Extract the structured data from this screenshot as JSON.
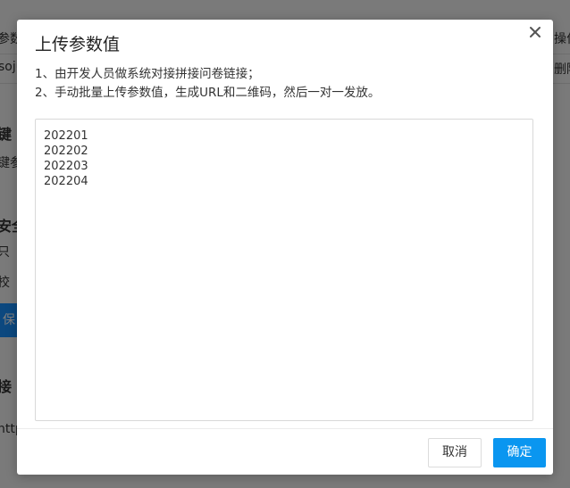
{
  "background": {
    "top_left_label": "参数",
    "top_left_value": "soju",
    "top_right_label": "操作",
    "top_right_value": "删除",
    "section_keyword_title": "键",
    "section_keyword_text": "键参",
    "section_security_title": "安全",
    "security_option_1": "只",
    "security_option_2": "校",
    "save_button_label": "保",
    "section_link_title": "接",
    "link_text": "http"
  },
  "modal": {
    "title": "上传参数值",
    "close_glyph": "×",
    "instructions": [
      "1、由开发人员做系统对接拼接问卷链接；",
      "2、手动批量上传参数值，生成URL和二维码，然后一对一发放。"
    ],
    "textarea_value": "202201\n202202\n202203\n202204",
    "cancel_label": "取消",
    "confirm_label": "确定"
  },
  "colors": {
    "primary": "#0a96f0",
    "overlay": "rgba(0,0,0,0.5)"
  }
}
